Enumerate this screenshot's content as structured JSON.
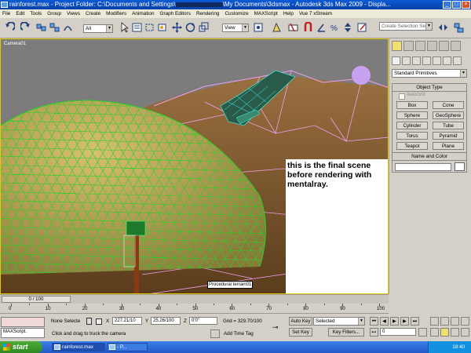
{
  "window": {
    "title": "rainforest.max   - Project Folder: C:\\Documents and Settings\\",
    "title_tail": "\\My Documents\\3dsmax   - Autodesk 3ds Max  2009     - Displa..."
  },
  "menu": [
    "File",
    "Edit",
    "Tools",
    "Group",
    "Views",
    "Create",
    "Modifiers",
    "Animation",
    "Graph Editors",
    "Rendering",
    "Customize",
    "MAXScript",
    "Help",
    "Vue 7 xStream"
  ],
  "toolbar": {
    "selection_filter": "All",
    "ref_coord": "View",
    "named_selection_placeholder": "Create Selection Set"
  },
  "viewport": {
    "label": "Camera01",
    "note": "this is the final scene before rendering with mentalray.",
    "object_label": "Procedural terrain01"
  },
  "command_panel": {
    "category": "Standard Primitives",
    "object_type_title": "Object Type",
    "autogrid": "AutoGrid",
    "objects": [
      "Box",
      "Cone",
      "Sphere",
      "GeoSphere",
      "Cylinder",
      "Tube",
      "Torus",
      "Pyramid",
      "Teapot",
      "Plane"
    ],
    "name_color_title": "Name and Color"
  },
  "timeline": {
    "frame_display": "0 / 100",
    "ticks": [
      "0",
      "10",
      "20",
      "30",
      "40",
      "50",
      "60",
      "70",
      "80",
      "90",
      "100"
    ]
  },
  "status": {
    "maxscript": "MAXScript.",
    "selection": "None Selecte",
    "x": "227.21/10",
    "y": "25.26/100",
    "z": "0'0\"",
    "grid": "Grid = 329.70/100",
    "auto_key": "Auto Key",
    "set_key": "Set Key",
    "key_mode": "Selected",
    "key_filters": "Key Filters...",
    "prompt": "Click and drag to truck the camera",
    "add_time_tag": "Add Time Tag",
    "current_frame": "0"
  },
  "taskbar": {
    "start": "start",
    "items": [
      "rainforest.max",
      "- P..."
    ],
    "clock": "18:40"
  },
  "colors": {
    "sky": "#808080",
    "dome_wire": "#22cc22",
    "terrain_wire": "#f0a0f0",
    "moon": "#c8a0f0",
    "title_blue": "#0a5ad6",
    "taskbar_blue": "#2458c8"
  }
}
